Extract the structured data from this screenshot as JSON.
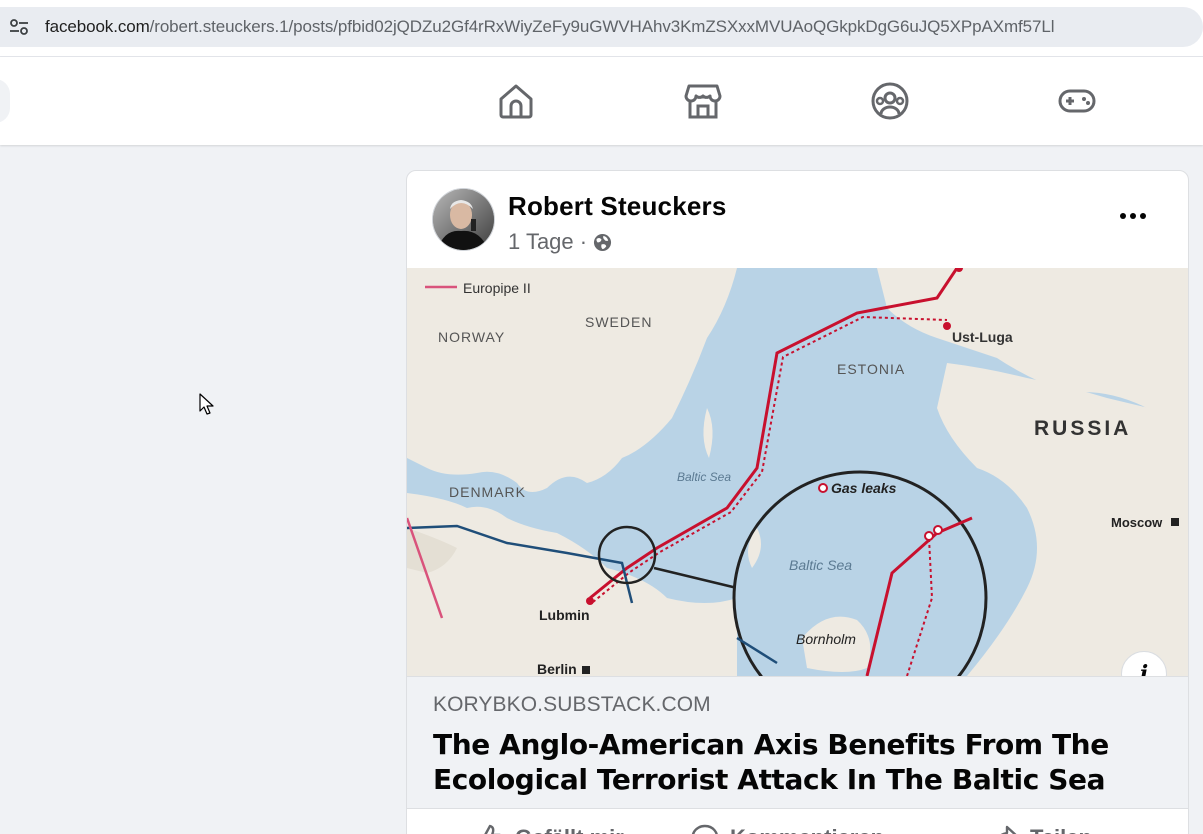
{
  "browser": {
    "url_host": "facebook.com",
    "url_path": "/robert.steuckers.1/posts/pfbid02jQDZu2Gf4rRxWiyZeFy9uGWVHAhv3KmZSXxxMVUAoQGkpkDgG6uJQ5XPpAXmf57Ll"
  },
  "nav": {
    "tabs": [
      {
        "name": "home",
        "icon": "home-icon"
      },
      {
        "name": "marketplace",
        "icon": "marketplace-icon"
      },
      {
        "name": "groups",
        "icon": "groups-icon"
      },
      {
        "name": "gaming",
        "icon": "gaming-icon"
      }
    ]
  },
  "post": {
    "author": "Robert Steuckers",
    "time": "1 Tage ·",
    "privacy_icon": "globe-icon",
    "map_labels": {
      "europipe": "Europipe II",
      "norway": "NORWAY",
      "sweden": "SWEDEN",
      "estonia": "ESTONIA",
      "ust_luga": "Ust-Luga",
      "russia": "RUSSIA",
      "denmark": "DENMARK",
      "baltic_small": "Baltic Sea",
      "gas_leaks": "Gas leaks",
      "baltic_inset": "Baltic Sea",
      "moscow": "Moscow",
      "lubmin": "Lubmin",
      "bornholm": "Bornholm",
      "berlin": "Berlin"
    },
    "link": {
      "domain": "KORYBKO.SUBSTACK.COM",
      "title": "The Anglo-American Axis Benefits From The Ecological Terrorist Attack In The Baltic Sea"
    },
    "actions": {
      "like": "Gefällt mir",
      "comment": "Kommentieren",
      "share": "Teilen"
    }
  },
  "colors": {
    "fb_icon_gray": "#65676b",
    "pipeline_red": "#c8102e",
    "pipeline_blue": "#1f4e79",
    "sea": "#b9d3e6",
    "land": "#eeeae2"
  }
}
